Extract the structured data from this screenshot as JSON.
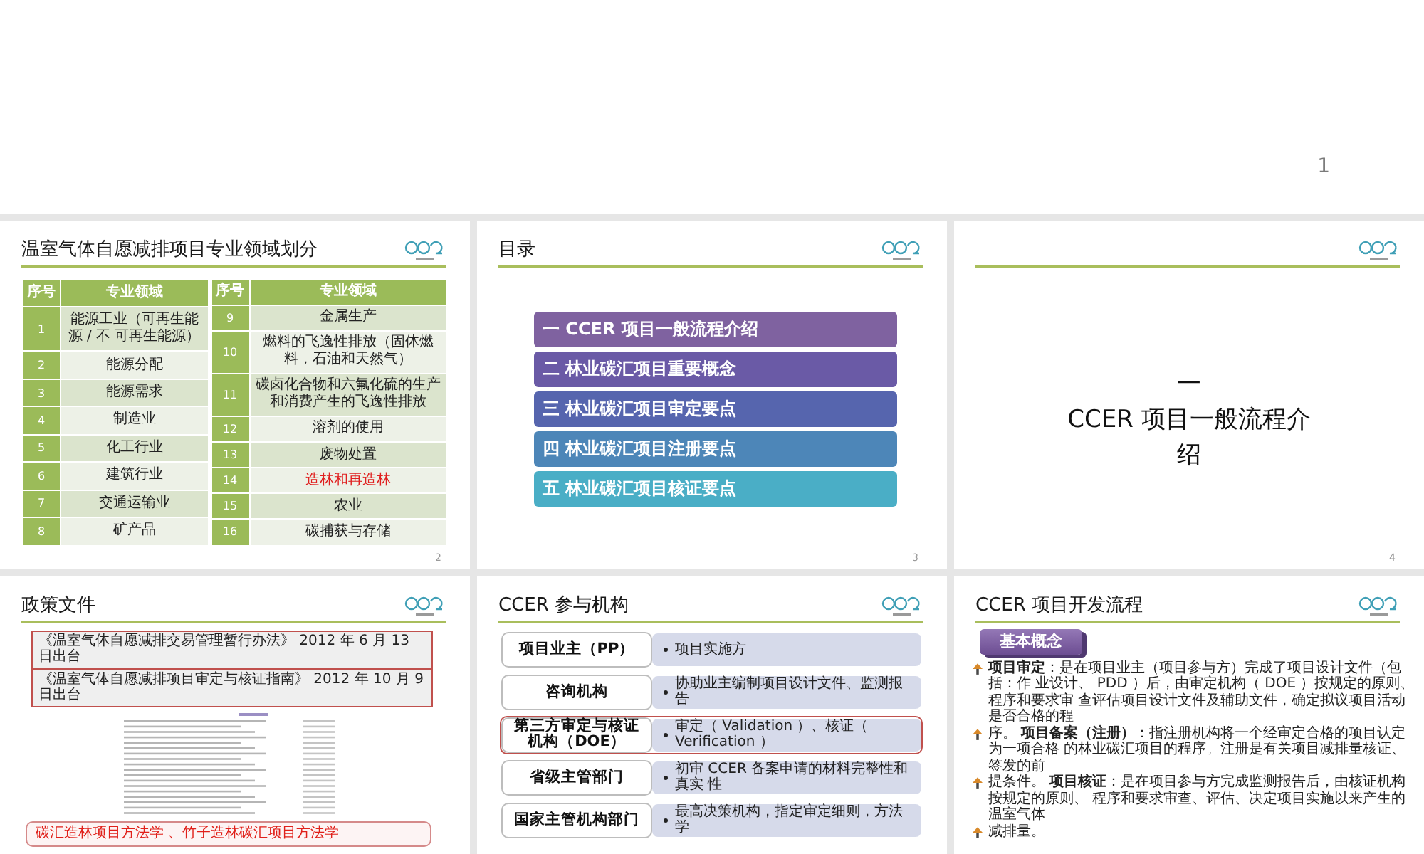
{
  "slides": [
    {
      "kind": "blank",
      "number": "1"
    },
    {
      "kind": "table",
      "title": "温室气体自愿减排项目专业领域划分",
      "number": "2",
      "tables": [
        {
          "columns": [
            "序号",
            "专业领域"
          ],
          "rows": [
            {
              "index": "1",
              "field": "能源工业（可再生能源 / 不 可再生能源）",
              "highlighted": false
            },
            {
              "index": "2",
              "field": "能源分配",
              "highlighted": false
            },
            {
              "index": "3",
              "field": "能源需求",
              "highlighted": false
            },
            {
              "index": "4",
              "field": "制造业",
              "highlighted": false
            },
            {
              "index": "5",
              "field": "化工行业",
              "highlighted": false
            },
            {
              "index": "6",
              "field": "建筑行业",
              "highlighted": false
            },
            {
              "index": "7",
              "field": "交通运输业",
              "highlighted": false
            },
            {
              "index": "8",
              "field": "矿产品",
              "highlighted": false
            }
          ]
        },
        {
          "columns": [
            "序号",
            "专业领域"
          ],
          "rows": [
            {
              "index": "9",
              "field": "金属生产",
              "highlighted": false
            },
            {
              "index": "10",
              "field": "燃料的飞逸性排放（固体燃料，石油和天然气）",
              "highlighted": false
            },
            {
              "index": "11",
              "field": "碳卤化合物和六氟化硫的生产和消费产生的飞逸性排放",
              "highlighted": false
            },
            {
              "index": "12",
              "field": "溶剂的使用",
              "highlighted": false
            },
            {
              "index": "13",
              "field": "废物处置",
              "highlighted": false
            },
            {
              "index": "14",
              "field": "造林和再造林",
              "highlighted": true
            },
            {
              "index": "15",
              "field": "农业",
              "highlighted": false
            },
            {
              "index": "16",
              "field": "碳捕获与存储",
              "highlighted": false
            }
          ]
        }
      ]
    },
    {
      "kind": "contents",
      "title": "目录",
      "number": "3",
      "items": [
        {
          "label": "一  CCER 项目一般流程介绍",
          "color": "#7f62a0"
        },
        {
          "label": "二 林业碳汇项目重要概念",
          "color": "#6a5aa6"
        },
        {
          "label": "三 林业碳汇项目审定要点",
          "color": "#5665ae"
        },
        {
          "label": "四 林业碳汇项目注册要点",
          "color": "#4d86b8"
        },
        {
          "label": "五 林业碳汇项目核证要点",
          "color": "#4aaec6"
        }
      ]
    },
    {
      "kind": "section",
      "number": "4",
      "section_number": "一",
      "section_title": "CCER 项目一般流程介绍"
    },
    {
      "kind": "documents",
      "title": "政策文件",
      "documents": [
        "《温室气体自愿减排交易管理暂行办法》 2012 年 6 月 13 日出台",
        "《温室气体自愿减排项目审定与核证指南》 2012 年 10 月 9 日出台"
      ],
      "note": "碳汇造林项目方法学 、竹子造林碳汇项目方法学"
    },
    {
      "kind": "organizations",
      "title": "CCER 参与机构",
      "rows": [
        {
          "name": "项目业主（PP）",
          "role": "项目实施方",
          "highlighted": false
        },
        {
          "name": "咨询机构",
          "role": "协助业主编制项目设计文件、监测报告",
          "highlighted": false
        },
        {
          "name": "第三方审定与核证机构（DOE）",
          "role": "审定（ Validation ）、核证（ Verification ）",
          "highlighted": true
        },
        {
          "name": "省级主管部门",
          "role": "初审 CCER 备案申请的材料完整性和真实 性",
          "highlighted": false
        },
        {
          "name": "国家主管机构部门",
          "role": "最高决策机构，指定审定细则，方法学",
          "highlighted": false
        }
      ]
    },
    {
      "kind": "concepts",
      "title": "CCER 项目开发流程",
      "tag": "基本概念",
      "bullets": [
        "**项目审定**：是在项目业主（项目参与方）完成了项目设计文件（包括：作 业设计、 PDD ）后，由审定机构（ DOE ）按规定的原则、程序和要求审 查评估项目设计文件及辅助文件，确定拟议项目活动是否合格的程",
        "序。 **项目备案（注册）**：指注册机构将一个经审定合格的项目认定为一项合格 的林业碳汇项目的程序。注册是有关项目减排量核证、签发的前",
        "提条件。 **项目核证**：是在项目参与方完成监测报告后，由核证机构按规定的原则、 程序和要求审查、评估、决定项目实施以来产生的温室气体",
        "减排量。"
      ]
    }
  ]
}
